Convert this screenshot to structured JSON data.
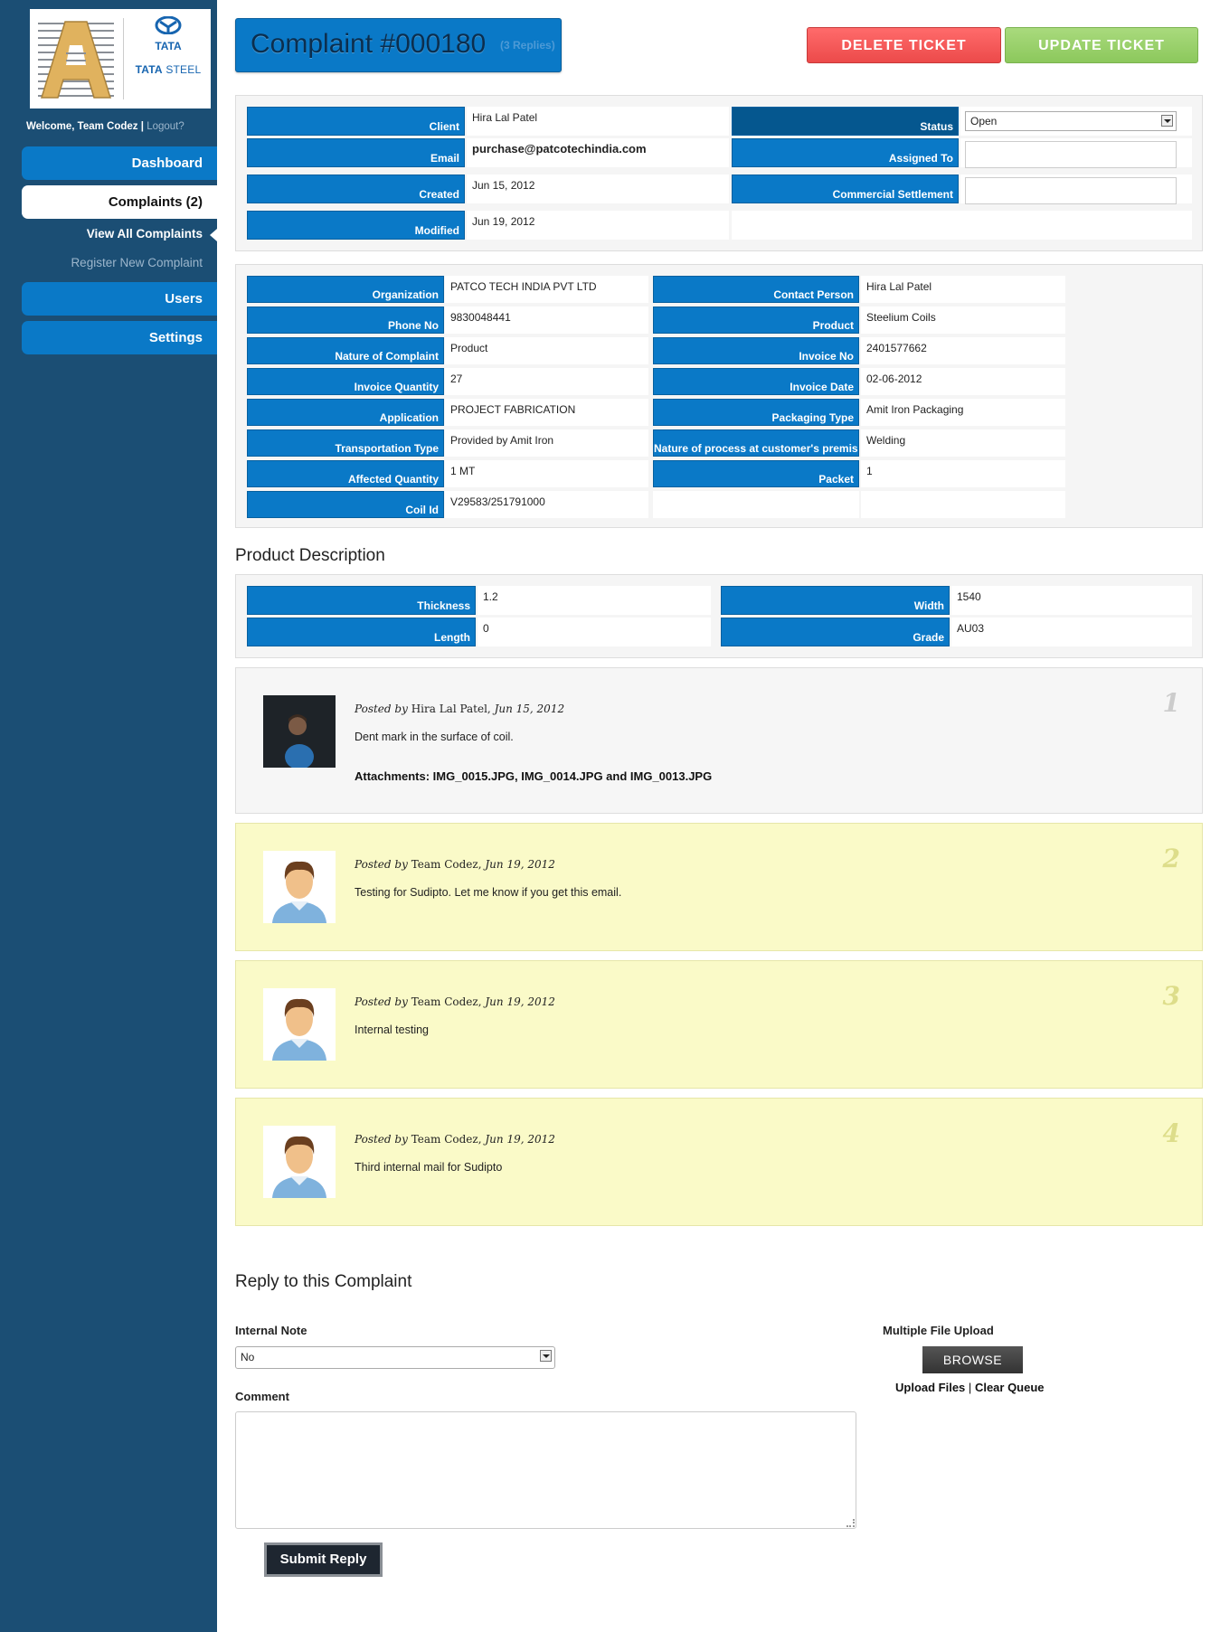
{
  "sidebar": {
    "logo": {
      "brand": "TATA",
      "product_prefix": "TATA",
      "product_suffix": "STEEL"
    },
    "welcome_text": "Welcome, Team Codez",
    "separator": "|",
    "logout_label": "Logout?",
    "nav": {
      "dashboard": "Dashboard",
      "complaints": "Complaints (2)",
      "view_all": "View All Complaints",
      "register_new": "Register New Complaint",
      "users": "Users",
      "settings": "Settings"
    }
  },
  "header": {
    "title": "Complaint #000180",
    "replies": "(3 Replies)",
    "delete_label": "DELETE TICKET",
    "update_label": "UPDATE TICKET"
  },
  "ticket": {
    "client_label": "Client",
    "client_value": "Hira Lal Patel",
    "email_label": "Email",
    "email_value": "purchase@patcotechindia.com",
    "created_label": "Created",
    "created_value": "Jun 15, 2012",
    "modified_label": "Modified",
    "modified_value": "Jun 19, 2012",
    "status_label": "Status",
    "status_value": "Open",
    "assigned_label": "Assigned To",
    "assigned_value": "",
    "settlement_label": "Commercial Settlement",
    "settlement_value": ""
  },
  "details": {
    "left": [
      {
        "label": "Organization",
        "value": "PATCO TECH INDIA PVT LTD"
      },
      {
        "label": "Phone No",
        "value": "9830048441"
      },
      {
        "label": "Nature of Complaint",
        "value": "Product"
      },
      {
        "label": "Invoice Quantity",
        "value": "27"
      },
      {
        "label": "Application",
        "value": "PROJECT FABRICATION"
      },
      {
        "label": "Transportation Type",
        "value": "Provided by Amit Iron"
      },
      {
        "label": "Affected Quantity",
        "value": "1 MT"
      },
      {
        "label": "Coil Id",
        "value": "V29583/251791000"
      }
    ],
    "right": [
      {
        "label": "Contact Person",
        "value": "Hira Lal Patel"
      },
      {
        "label": "Product",
        "value": "Steelium Coils"
      },
      {
        "label": "Invoice No",
        "value": "2401577662"
      },
      {
        "label": "Invoice Date",
        "value": "02-06-2012"
      },
      {
        "label": "Packaging Type",
        "value": "Amit Iron Packaging"
      },
      {
        "label": "Nature of process at customer's premises",
        "value": "Welding"
      },
      {
        "label": "Packet",
        "value": "1"
      }
    ]
  },
  "product_description": {
    "title": "Product Description",
    "thickness_label": "Thickness",
    "thickness_value": "1.2",
    "length_label": "Length",
    "length_value": "0",
    "width_label": "Width",
    "width_value": "1540",
    "grade_label": "Grade",
    "grade_value": "AU03"
  },
  "posts": [
    {
      "num": "1",
      "posted_by": "Posted by",
      "author": "Hira Lal Patel",
      "date": "Jun 15, 2012",
      "body": "Dent mark in the surface of coil.",
      "attachments": "Attachments: IMG_0015.JPG, IMG_0014.JPG and IMG_0013.JPG"
    },
    {
      "num": "2",
      "posted_by": "Posted by",
      "author": "Team Codez",
      "date": "Jun 19, 2012",
      "body": "Testing for Sudipto. Let me know if you get this email."
    },
    {
      "num": "3",
      "posted_by": "Posted by",
      "author": "Team Codez",
      "date": "Jun 19, 2012",
      "body": "Internal testing"
    },
    {
      "num": "4",
      "posted_by": "Posted by",
      "author": "Team Codez",
      "date": "Jun 19, 2012",
      "body": "Third internal mail for Sudipto"
    }
  ],
  "reply": {
    "title": "Reply to this Complaint",
    "internal_note_label": "Internal Note",
    "internal_note_value": "No",
    "comment_label": "Comment",
    "comment_value": "",
    "upload_label": "Multiple File Upload",
    "browse_label": "BROWSE",
    "upload_files_label": "Upload Files",
    "upload_separator": "|",
    "clear_queue_label": "Clear Queue",
    "submit_label": "Submit Reply"
  },
  "colors": {
    "sidebar_bg": "#1b4e74",
    "accent_blue": "#0a79c7",
    "delete_red": "#ec4a4a",
    "update_green": "#8cc85c",
    "reply_yellow": "#fafac8"
  },
  "icons": {
    "customer_avatar": "dark-user-avatar-icon",
    "staff_avatar": "male-user-avatar-icon",
    "select_arrow": "chevron-down-icon"
  }
}
